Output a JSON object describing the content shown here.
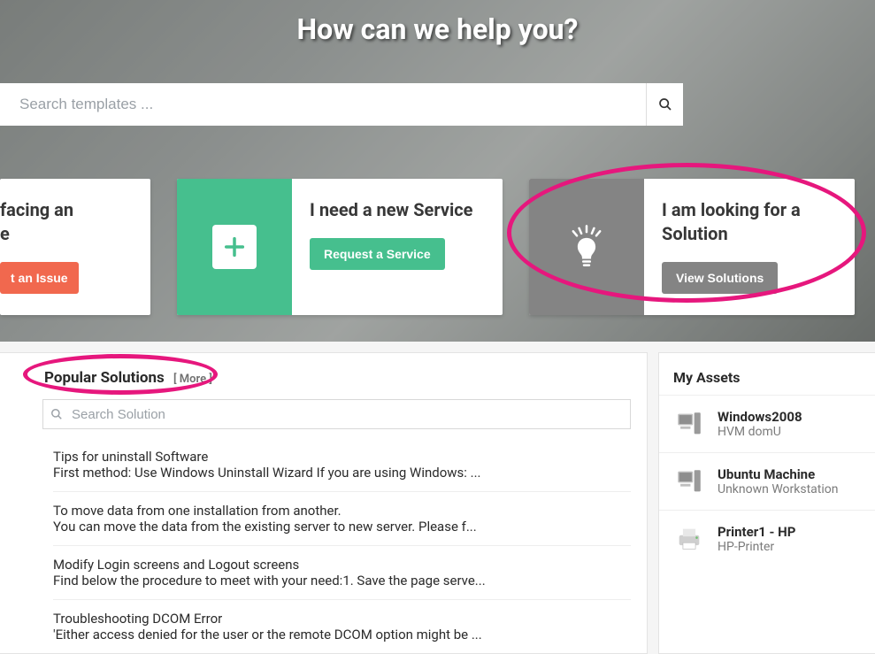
{
  "hero": {
    "title": "How can we help you?",
    "search_placeholder": "Search templates ..."
  },
  "cards": {
    "issue": {
      "title": "facing an\n e",
      "button": "t an Issue"
    },
    "service": {
      "title": "I need a new Service",
      "button": "Request a Service"
    },
    "solution": {
      "title": "I am looking for a Solution",
      "button": "View Solutions"
    }
  },
  "popular": {
    "header": "Popular Solutions",
    "more": "[ More ]",
    "search_placeholder": "Search Solution",
    "items": [
      {
        "title": "Tips for uninstall Software",
        "desc": "First method: Use Windows Uninstall Wizard If you are using Windows: ..."
      },
      {
        "title": "To move data from one installation from another.",
        "desc": "You can move the data from the existing server to new server. Please f..."
      },
      {
        "title": "Modify Login screens and Logout screens",
        "desc": "Find below the procedure to meet with your need:1. Save the page serve..."
      },
      {
        "title": "Troubleshooting DCOM Error",
        "desc": "'Either access denied for the user or the remote DCOM option might be ..."
      }
    ]
  },
  "assets": {
    "header": "My Assets",
    "items": [
      {
        "name": "Windows2008",
        "sub": "HVM domU",
        "icon": "workstation"
      },
      {
        "name": "Ubuntu Machine",
        "sub": "Unknown Workstation",
        "icon": "workstation"
      },
      {
        "name": "Printer1 - HP",
        "sub": "HP-Printer",
        "icon": "printer"
      }
    ]
  }
}
